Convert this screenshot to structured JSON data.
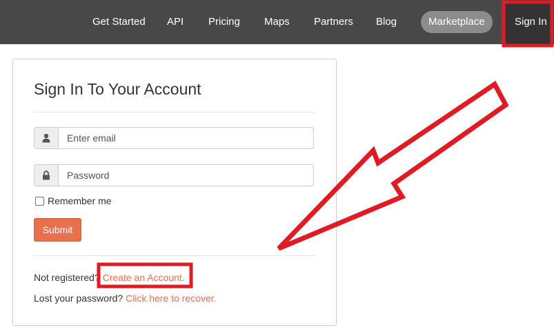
{
  "nav": {
    "items": [
      "Get Started",
      "API",
      "Pricing",
      "Maps",
      "Partners",
      "Blog"
    ],
    "marketplace_label": "Marketplace",
    "signin_label": "Sign In"
  },
  "login": {
    "title": "Sign In To Your Account",
    "email_placeholder": "Enter email",
    "password_placeholder": "Password",
    "remember_label": "Remember me",
    "submit_label": "Submit",
    "not_registered_text": "Not registered?",
    "create_account_link": "Create an Account.",
    "lost_password_text": "Lost your password?",
    "recover_link": "Click here to recover."
  },
  "icons": {
    "email": "user-icon",
    "password": "lock-icon"
  },
  "colors": {
    "navbar": "#484848",
    "accent": "#e8704f",
    "annotation": "#e01b24"
  }
}
